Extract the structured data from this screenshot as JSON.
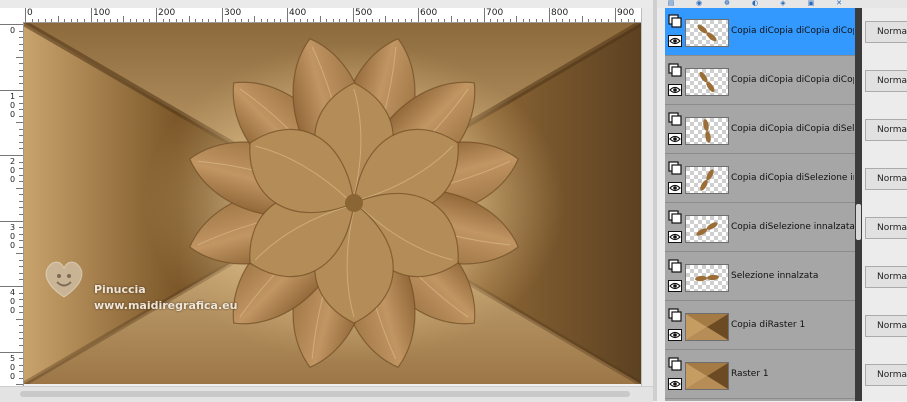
{
  "rulers": {
    "horizontal": [
      "0",
      "100",
      "200",
      "300",
      "400",
      "500",
      "600",
      "700",
      "800",
      "900"
    ],
    "vertical": [
      {
        "digits": [
          "0"
        ]
      },
      {
        "digits": [
          "1",
          "0",
          "0"
        ]
      },
      {
        "digits": [
          "2",
          "0",
          "0"
        ]
      },
      {
        "digits": [
          "3",
          "0",
          "0"
        ]
      },
      {
        "digits": [
          "4",
          "0",
          "0"
        ]
      },
      {
        "digits": [
          "5",
          "0",
          "0"
        ]
      }
    ]
  },
  "canvas": {
    "watermark": {
      "name": "Pinuccia",
      "url": "www.maidiregrafica.eu",
      "icon": "heart-smiley-icon"
    },
    "colors": {
      "dark": "#5c4121",
      "mid": "#a87d48",
      "light": "#cba570",
      "highlight": "#ecd6ae",
      "petal": "#b28a55"
    }
  },
  "layers_panel": {
    "toolbar_icons": [
      "layers-icon",
      "eye-icon",
      "link-icon",
      "mask-icon",
      "adjust-icon",
      "group-icon",
      "delete-icon"
    ],
    "layers": [
      {
        "name": "Copia diCopia diCopia diCopia d",
        "blend": "Normal",
        "selected": true,
        "thumb": "petal"
      },
      {
        "name": "Copia diCopia diCopia diCopia d",
        "blend": "Normal",
        "selected": false,
        "thumb": "petal"
      },
      {
        "name": "Copia diCopia diCopia diSelezio",
        "blend": "Normal",
        "selected": false,
        "thumb": "petal"
      },
      {
        "name": "Copia diCopia diSelezione innalz",
        "blend": "Normal",
        "selected": false,
        "thumb": "petal"
      },
      {
        "name": "Copia diSelezione innalzata",
        "blend": "Normal",
        "selected": false,
        "thumb": "petal"
      },
      {
        "name": "Selezione innalzata",
        "blend": "Normal",
        "selected": false,
        "thumb": "petal"
      },
      {
        "name": "Copia diRaster 1",
        "blend": "Normal",
        "selected": false,
        "thumb": "raster"
      },
      {
        "name": "Raster 1",
        "blend": "Normal",
        "selected": false,
        "thumb": "raster"
      }
    ]
  }
}
